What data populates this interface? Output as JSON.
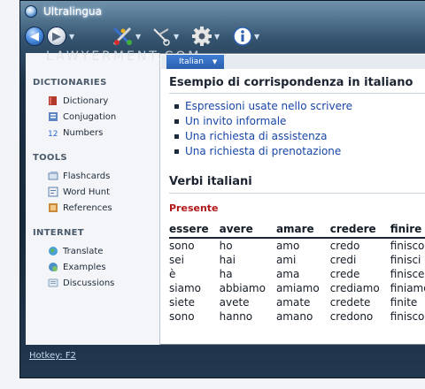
{
  "window": {
    "title": "Ultralingua",
    "watermark": "LAWYERMENT.COM"
  },
  "toolbar": {
    "back_icon": "back-arrow-icon",
    "forward_icon": "forward-arrow-icon",
    "tools_icon": "tools-icon",
    "scissors_icon": "scissors-icon",
    "settings_icon": "gear-icon",
    "info_icon": "info-icon"
  },
  "language_tab": {
    "label": "Italian",
    "arrow": "▼"
  },
  "sidebar": {
    "sections": [
      {
        "title": "DICTIONARIES",
        "items": [
          {
            "label": "Dictionary",
            "icon": "book-icon"
          },
          {
            "label": "Conjugation",
            "icon": "conjugation-icon"
          },
          {
            "label": "Numbers",
            "icon": "numbers-icon"
          }
        ]
      },
      {
        "title": "TOOLS",
        "items": [
          {
            "label": "Flashcards",
            "icon": "flashcards-icon"
          },
          {
            "label": "Word Hunt",
            "icon": "word-hunt-icon"
          },
          {
            "label": "References",
            "icon": "references-icon"
          }
        ]
      },
      {
        "title": "INTERNET",
        "items": [
          {
            "label": "Translate",
            "icon": "globe-icon"
          },
          {
            "label": "Examples",
            "icon": "examples-icon"
          },
          {
            "label": "Discussions",
            "icon": "discussions-icon"
          }
        ]
      }
    ]
  },
  "content": {
    "heading": "Esempio di corrispondenza in italiano",
    "links": [
      "Espressioni usate nello scrivere",
      "Un invito informale",
      "Una richiesta di assistenza",
      "Una richiesta di prenotazione"
    ],
    "verbs_heading": "Verbi italiani",
    "tense": "Presente",
    "table": {
      "headers": [
        "essere",
        "avere",
        "amare",
        "credere",
        "finire"
      ],
      "rows": [
        [
          "sono",
          "ho",
          "amo",
          "credo",
          "finisco"
        ],
        [
          "sei",
          "hai",
          "ami",
          "credi",
          "finisci"
        ],
        [
          "è",
          "ha",
          "ama",
          "crede",
          "finisce"
        ],
        [
          "siamo",
          "abbiamo",
          "amiamo",
          "crediamo",
          "finiamo"
        ],
        [
          "siete",
          "avete",
          "amate",
          "credete",
          "finite"
        ],
        [
          "sono",
          "hanno",
          "amano",
          "credono",
          "finiscono"
        ]
      ]
    }
  },
  "statusbar": {
    "hotkey": "Hotkey: F2"
  },
  "colors": {
    "frame": "#1d3248",
    "link": "#1846a6",
    "tense": "#b11818",
    "tab": "#2a5fae"
  }
}
